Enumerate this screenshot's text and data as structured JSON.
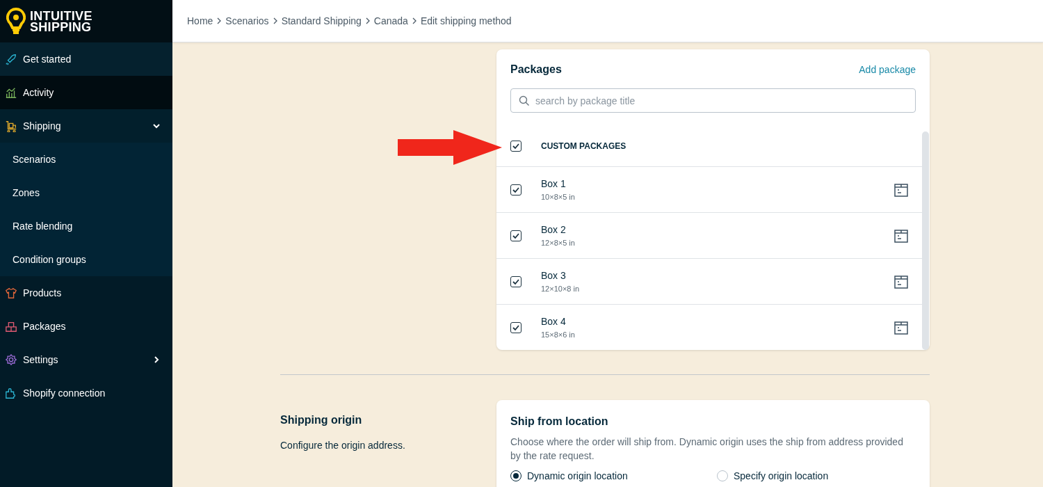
{
  "logo": {
    "line_1": "INTUITIVE",
    "line_2": "SHIPPING"
  },
  "sidebar": {
    "items": [
      {
        "label": "Get started",
        "kind": "link",
        "selected": false
      },
      {
        "label": "Activity",
        "kind": "link",
        "selected": true
      },
      {
        "label": "Shipping",
        "kind": "group",
        "selected": false,
        "expanded": true,
        "children": [
          {
            "label": "Scenarios"
          },
          {
            "label": "Zones"
          },
          {
            "label": "Rate blending"
          },
          {
            "label": "Condition groups"
          }
        ]
      },
      {
        "label": "Products",
        "kind": "link",
        "selected": false
      },
      {
        "label": "Packages",
        "kind": "link",
        "selected": false
      },
      {
        "label": "Settings",
        "kind": "group",
        "selected": false,
        "expanded": false
      },
      {
        "label": "Shopify connection",
        "kind": "link",
        "selected": false
      }
    ]
  },
  "breadcrumb": [
    "Home",
    "Scenarios",
    "Standard Shipping",
    "Canada",
    "Edit shipping method"
  ],
  "packages_card": {
    "title": "Packages",
    "action": "Add package",
    "search": {
      "placeholder": "search by package title"
    },
    "group": {
      "label": "CUSTOM PACKAGES",
      "checked": true
    },
    "packages": [
      {
        "name": "Box 1",
        "size": "10×8×5 in",
        "checked": true
      },
      {
        "name": "Box 2",
        "size": "12×8×5 in",
        "checked": true
      },
      {
        "name": "Box 3",
        "size": "12×10×8 in",
        "checked": true
      },
      {
        "name": "Box 4",
        "size": "15×8×6 in",
        "checked": true
      }
    ]
  },
  "origin_section": {
    "title": "Shipping origin",
    "description": "Configure the origin address.",
    "card": {
      "title": "Ship from location",
      "description": "Choose where the order will ship from. Dynamic origin uses the ship from address provided by the rate request.",
      "options": [
        {
          "label": "Dynamic origin location",
          "selected": true
        },
        {
          "label": "Specify origin location",
          "selected": false
        }
      ]
    }
  }
}
